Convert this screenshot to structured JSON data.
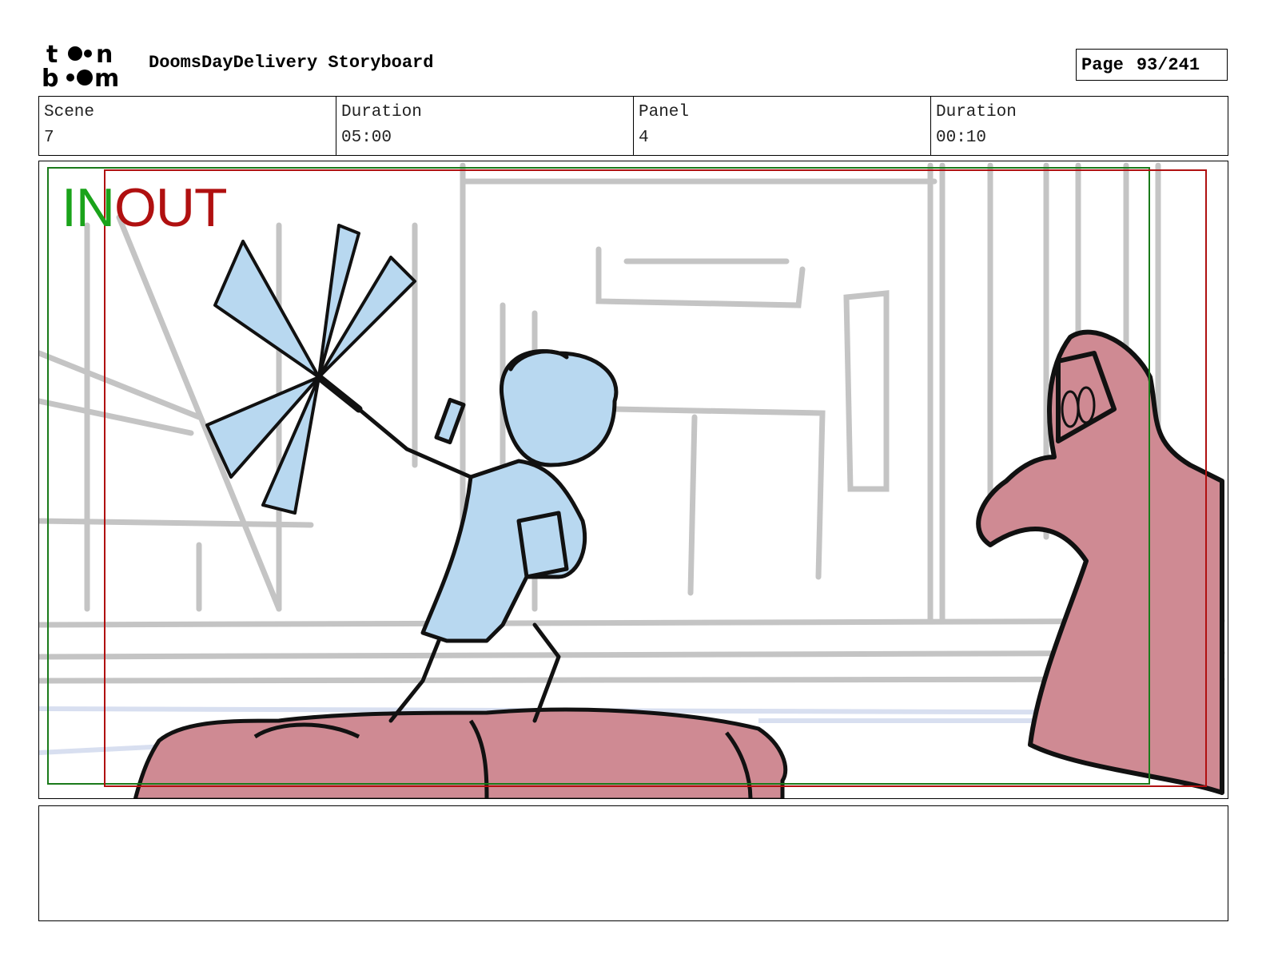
{
  "header": {
    "logo_text": "toon boom",
    "title": "DoomsDayDelivery Storyboard",
    "page_label": "Page",
    "page_value": "93/241"
  },
  "info": {
    "scene_label": "Scene",
    "scene_value": "7",
    "scene_duration_label": "Duration",
    "scene_duration_value": "05:00",
    "panel_label": "Panel",
    "panel_value": "4",
    "panel_duration_label": "Duration",
    "panel_duration_value": "00:10"
  },
  "panel": {
    "in_label": "IN",
    "out_label": "OUT",
    "in_color": "#1aa31a",
    "out_color": "#b01010",
    "character_color": "#b8d8f0",
    "creature_color": "#cf8a93",
    "background_line_color": "#c4c4c4"
  },
  "notes": {
    "text": ""
  }
}
